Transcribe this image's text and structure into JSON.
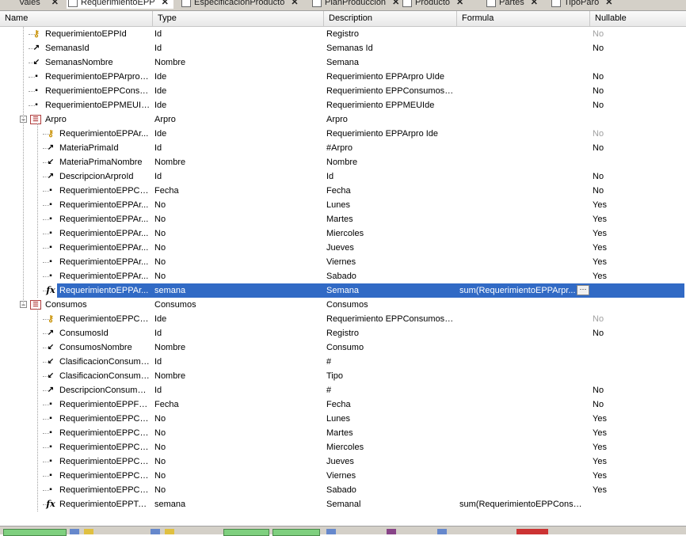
{
  "tabs": [
    {
      "label": "Vales",
      "active": false
    },
    {
      "label": "RequerimientoEPP",
      "active": true
    },
    {
      "label": "EspecificacionProducto",
      "active": false
    },
    {
      "label": "PlanProduccion",
      "active": false
    },
    {
      "label": "Producto",
      "active": false
    },
    {
      "label": "Partes",
      "active": false
    },
    {
      "label": "TipoParo",
      "active": false
    }
  ],
  "columns": {
    "name": "Name",
    "type": "Type",
    "description": "Description",
    "formula": "Formula",
    "nullable": "Nullable"
  },
  "rows": [
    {
      "name": "RequerimientoEPPId",
      "icon": "key",
      "type": "Id",
      "description": "Registro",
      "formula": "",
      "nullable": "No",
      "nullable_disabled": true
    },
    {
      "name": "SemanasId",
      "icon": "fk",
      "type": "Id",
      "description": "Semanas Id",
      "formula": "",
      "nullable": "No"
    },
    {
      "name": "SemanasNombre",
      "icon": "inferred",
      "type": "Nombre",
      "description": "Semana",
      "formula": "",
      "nullable": ""
    },
    {
      "name": "RequerimientoEPPArproU...",
      "icon": "attr",
      "type": "Ide",
      "description": "Requerimiento EPPArpro UIde",
      "formula": "",
      "nullable": "No"
    },
    {
      "name": "RequerimientoEPPConsu...",
      "icon": "attr",
      "type": "Ide",
      "description": "Requerimiento EPPConsumos U...",
      "formula": "",
      "nullable": "No"
    },
    {
      "name": "RequerimientoEPPMEUIde",
      "icon": "attr",
      "type": "Ide",
      "description": "Requerimiento EPPMEUIde",
      "formula": "",
      "nullable": "No"
    },
    {
      "name": "Arpro",
      "icon": "level",
      "type": "Arpro",
      "description": "Arpro",
      "formula": "",
      "nullable": ""
    },
    {
      "name": "RequerimientoEPPAr...",
      "icon": "key",
      "type": "Ide",
      "description": "Requerimiento EPPArpro Ide",
      "formula": "",
      "nullable": "No",
      "nullable_disabled": true
    },
    {
      "name": "MateriaPrimaId",
      "icon": "fk",
      "type": "Id",
      "description": "#Arpro",
      "formula": "",
      "nullable": "No"
    },
    {
      "name": "MateriaPrimaNombre",
      "icon": "inferred",
      "type": "Nombre",
      "description": "Nombre",
      "formula": "",
      "nullable": ""
    },
    {
      "name": "DescripcionArproId",
      "icon": "fk",
      "type": "Id",
      "description": "Id",
      "formula": "",
      "nullable": "No"
    },
    {
      "name": "RequerimientoEPPCo...",
      "icon": "attr",
      "type": "Fecha",
      "description": "Fecha",
      "formula": "",
      "nullable": "No"
    },
    {
      "name": "RequerimientoEPPAr...",
      "icon": "attr",
      "type": "No",
      "description": " Lunes",
      "formula": "",
      "nullable": "Yes"
    },
    {
      "name": "RequerimientoEPPAr...",
      "icon": "attr",
      "type": "No",
      "description": "Martes",
      "formula": "",
      "nullable": "Yes"
    },
    {
      "name": "RequerimientoEPPAr...",
      "icon": "attr",
      "type": "No",
      "description": "Miercoles",
      "formula": "",
      "nullable": "Yes"
    },
    {
      "name": "RequerimientoEPPAr...",
      "icon": "attr",
      "type": "No",
      "description": "Jueves",
      "formula": "",
      "nullable": "Yes"
    },
    {
      "name": "RequerimientoEPPAr...",
      "icon": "attr",
      "type": "No",
      "description": "Viernes",
      "formula": "",
      "nullable": "Yes"
    },
    {
      "name": "RequerimientoEPPAr...",
      "icon": "attr",
      "type": "No",
      "description": "Sabado",
      "formula": "",
      "nullable": "Yes"
    },
    {
      "name": "RequerimientoEPPAr...",
      "icon": "formula",
      "type": "semana",
      "description": "Semana",
      "formula": "sum(RequerimientoEPPArpr...",
      "nullable": "",
      "selected": true
    },
    {
      "name": "Consumos",
      "icon": "level",
      "type": "Consumos",
      "description": "Consumos",
      "formula": "",
      "nullable": ""
    },
    {
      "name": "RequerimientoEPPCo...",
      "icon": "key",
      "type": "Ide",
      "description": "Requerimiento EPPConsumos Ide",
      "formula": "",
      "nullable": "No",
      "nullable_disabled": true
    },
    {
      "name": "ConsumosId",
      "icon": "fk",
      "type": "Id",
      "description": "Registro",
      "formula": "",
      "nullable": "No"
    },
    {
      "name": "ConsumosNombre",
      "icon": "inferred",
      "type": "Nombre",
      "description": "Consumo",
      "formula": "",
      "nullable": ""
    },
    {
      "name": "ClasificacionConsumo...",
      "icon": "inferred",
      "type": "Id",
      "description": "#",
      "formula": "",
      "nullable": ""
    },
    {
      "name": "ClasificacionConsumo...",
      "icon": "inferred",
      "type": "Nombre",
      "description": "Tipo",
      "formula": "",
      "nullable": ""
    },
    {
      "name": "DescripcionConsumosId",
      "icon": "fk",
      "type": "Id",
      "description": "#",
      "formula": "",
      "nullable": "No"
    },
    {
      "name": "RequerimientoEPPFe...",
      "icon": "attr",
      "type": "Fecha",
      "description": "Fecha",
      "formula": "",
      "nullable": "No"
    },
    {
      "name": "RequerimientoEPPCo...",
      "icon": "attr",
      "type": "No",
      "description": "Lunes",
      "formula": "",
      "nullable": "Yes"
    },
    {
      "name": "RequerimientoEPPCo...",
      "icon": "attr",
      "type": "No",
      "description": "Martes",
      "formula": "",
      "nullable": "Yes"
    },
    {
      "name": "RequerimientoEPPCo...",
      "icon": "attr",
      "type": "No",
      "description": "Miercoles",
      "formula": "",
      "nullable": "Yes"
    },
    {
      "name": "RequerimientoEPPCo...",
      "icon": "attr",
      "type": "No",
      "description": "Jueves",
      "formula": "",
      "nullable": "Yes"
    },
    {
      "name": "RequerimientoEPPCo...",
      "icon": "attr",
      "type": "No",
      "description": "Viernes",
      "formula": "",
      "nullable": "Yes"
    },
    {
      "name": "RequerimientoEPPCo...",
      "icon": "attr",
      "type": "No",
      "description": "Sabado",
      "formula": "",
      "nullable": "Yes"
    },
    {
      "name": "RequerimientoEPPTot...",
      "icon": "formula",
      "type": "semana",
      "description": "Semanal",
      "formula": "sum(RequerimientoEPPConsum...",
      "nullable": ""
    }
  ],
  "formula_button_label": "···",
  "colors": {
    "selection": "#316ac5",
    "header_bg": "#f4f4f4",
    "tab_bg": "#d4d0c8"
  }
}
